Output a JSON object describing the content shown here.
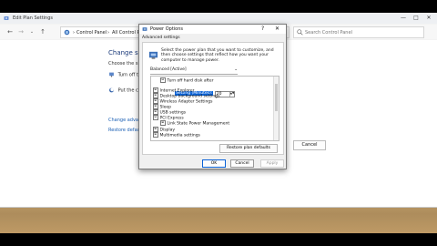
{
  "window": {
    "title": "Edit Plan Settings",
    "nav": {
      "back": "←",
      "forward": "→",
      "up": "↑"
    },
    "breadcrumbs": [
      "Control Panel",
      "All Control Pa"
    ],
    "search_placeholder": "Search Control Panel",
    "controls": {
      "minimize": "—",
      "maximize": "□",
      "close": "✕"
    }
  },
  "main": {
    "title": "Change setti",
    "subtitle": "Choose the slee",
    "rows": [
      "Turn off th",
      "Put the co"
    ],
    "links": [
      "Change advanc",
      "Restore default"
    ],
    "cancel_label": "Cancel"
  },
  "dialog": {
    "title": "Power Options",
    "help": "?",
    "close": "✕",
    "tab": "Advanced settings",
    "description": "Select the power plan that you want to customize, and then choose settings that reflect how you want your computer to manage power.",
    "plan": "Balanced [Active]",
    "tree": [
      {
        "label": "Turn off hard disk after",
        "expand": "⊟",
        "level": 2
      },
      {
        "label": "Internet Explorer",
        "expand": "⊞",
        "level": 1
      },
      {
        "label": "Desktop background settings",
        "expand": "⊞",
        "level": 1
      },
      {
        "label": "Wireless Adapter Settings",
        "expand": "⊞",
        "level": 1
      },
      {
        "label": "Sleep",
        "expand": "⊞",
        "level": 1
      },
      {
        "label": "USB settings",
        "expand": "⊞",
        "level": 1
      },
      {
        "label": "PCI Express",
        "expand": "⊟",
        "level": 1
      },
      {
        "label": "Link State Power Management",
        "expand": "⊞",
        "level": 2
      },
      {
        "label": "Display",
        "expand": "⊞",
        "level": 1
      },
      {
        "label": "Multimedia settings",
        "expand": "⊞",
        "level": 1
      }
    ],
    "setting_label": "Setting (Minutes):",
    "setting_value": "20",
    "restore_label": "Restore plan defaults",
    "ok_label": "OK",
    "cancel_label": "Cancel",
    "apply_label": "Apply"
  }
}
